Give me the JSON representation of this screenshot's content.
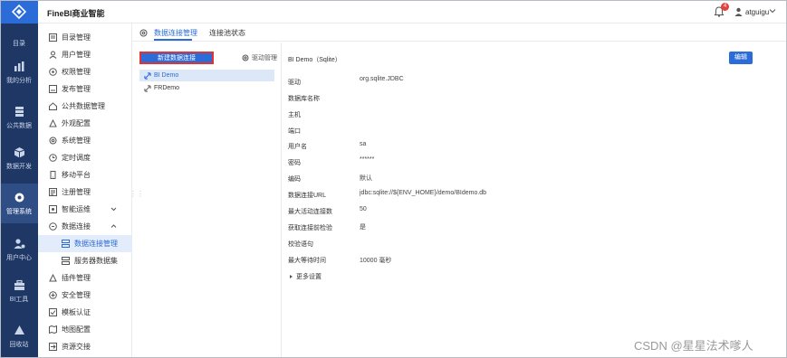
{
  "header": {
    "brand": "FineBI商业智能",
    "notification_count": "4",
    "username": "atguigu"
  },
  "rail": {
    "items": [
      {
        "label": "目录"
      },
      {
        "label": "我的分析"
      },
      {
        "label": "公共数据"
      },
      {
        "label": "数据开发"
      },
      {
        "label": "管理系统"
      },
      {
        "label": "用户中心"
      },
      {
        "label": "BI工具"
      },
      {
        "label": "回收站"
      }
    ]
  },
  "sidebar": {
    "items": [
      {
        "label": "目录管理"
      },
      {
        "label": "用户管理"
      },
      {
        "label": "权限管理"
      },
      {
        "label": "发布管理"
      },
      {
        "label": "公共数据管理"
      },
      {
        "label": "外观配置"
      },
      {
        "label": "系统管理"
      },
      {
        "label": "定时调度"
      },
      {
        "label": "移动平台"
      },
      {
        "label": "注册管理"
      },
      {
        "label": "智能运维"
      },
      {
        "label": "数据连接"
      },
      {
        "label": "数据连接管理"
      },
      {
        "label": "服务器数据集"
      },
      {
        "label": "插件管理"
      },
      {
        "label": "安全管理"
      },
      {
        "label": "模板认证"
      },
      {
        "label": "地图配置"
      },
      {
        "label": "资源交接"
      }
    ]
  },
  "tabs": {
    "items": [
      {
        "label": "数据连接管理"
      },
      {
        "label": "连接池状态"
      }
    ]
  },
  "connections": {
    "new_button": "新建数据连接",
    "driver_button": "驱动管理",
    "items": [
      {
        "label": "BI Demo"
      },
      {
        "label": "FRDemo"
      }
    ]
  },
  "detail": {
    "title": "BI Demo（Sqlite）",
    "edit_button": "编辑",
    "fields": [
      {
        "label": "驱动",
        "value": "org.sqlite.JDBC"
      },
      {
        "label": "数据库名称",
        "value": ""
      },
      {
        "label": "主机",
        "value": ""
      },
      {
        "label": "端口",
        "value": ""
      },
      {
        "label": "用户名",
        "value": "sa"
      },
      {
        "label": "密码",
        "value": "******"
      },
      {
        "label": "编码",
        "value": "默认"
      },
      {
        "label": "数据连接URL",
        "value": "jdbc:sqlite://${ENV_HOME}/demo/BIdemo.db"
      },
      {
        "label": "最大活动连接数",
        "value": "50"
      },
      {
        "label": "获取连接前检验",
        "value": "是"
      },
      {
        "label": "校验语句",
        "value": ""
      },
      {
        "label": "最大等待时间",
        "value": "10000 毫秒"
      }
    ],
    "more_settings": "更多设置"
  },
  "watermark": "CSDN @星星法术嗲人",
  "colors": {
    "rail_bg": "#1e3764",
    "accent": "#2b6cd8",
    "highlight_border": "#e03434",
    "selected_bg": "#e3ecfa"
  }
}
